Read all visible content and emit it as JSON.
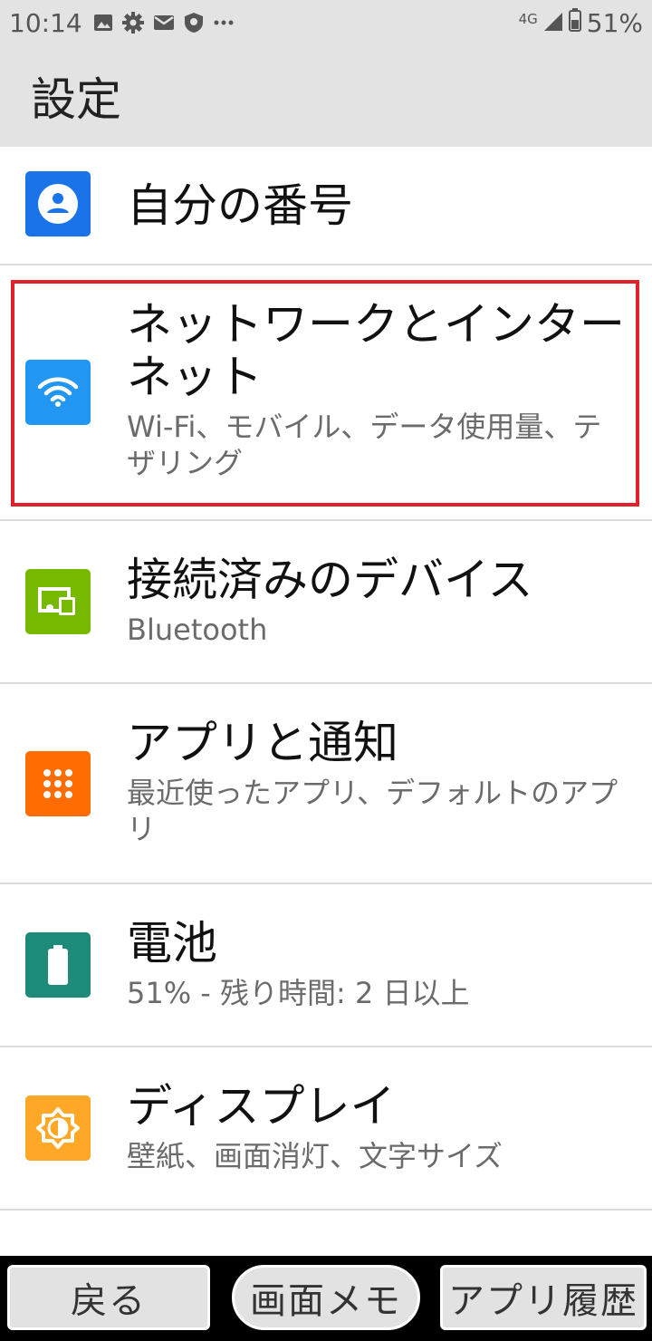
{
  "status_bar": {
    "time": "10:14",
    "network": "4G",
    "battery": "51%",
    "left_icons": [
      "image-icon",
      "gear-icon",
      "mail-icon",
      "shield-icon",
      "more-dots-icon"
    ]
  },
  "app_bar": {
    "title": "設定"
  },
  "items": [
    {
      "title": "自分の番号",
      "summary": "",
      "icon": "account-icon",
      "icon_color": "#1a73e8"
    },
    {
      "title": "ネットワークとインターネット",
      "summary": "Wi-Fi、モバイル、データ使用量、テザリング",
      "icon": "wifi-icon",
      "icon_color": "#2196f3"
    },
    {
      "title": "接続済みのデバイス",
      "summary": "Bluetooth",
      "icon": "devices-icon",
      "icon_color": "#76b900"
    },
    {
      "title": "アプリと通知",
      "summary": "最近使ったアプリ、デフォルトのアプリ",
      "icon": "apps-grid-icon",
      "icon_color": "#ff6d00"
    },
    {
      "title": "電池",
      "summary": "51% - 残り時間: 2 日以上",
      "icon": "battery-icon",
      "icon_color": "#1e8a7a"
    },
    {
      "title": "ディスプレイ",
      "summary": "壁紙、画面消灯、文字サイズ",
      "icon": "brightness-icon",
      "icon_color": "#ffa726"
    }
  ],
  "bottom_nav": {
    "back": "戻る",
    "screen_memo": "画面メモ",
    "app_history": "アプリ履歴"
  },
  "highlight_color": "#e0202a"
}
